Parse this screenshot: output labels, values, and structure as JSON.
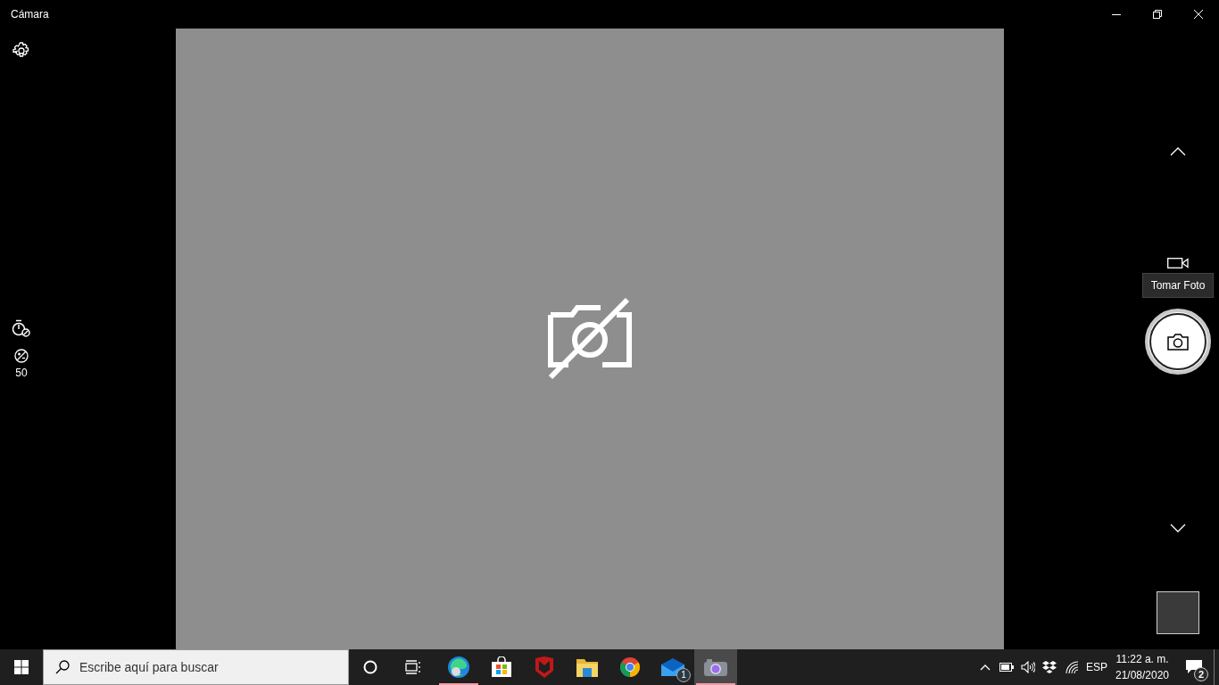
{
  "window": {
    "title": "Cámara"
  },
  "left_controls": [
    {
      "kind": "timer",
      "off": true
    },
    {
      "kind": "exposure",
      "reading": "50"
    }
  ],
  "preview": {
    "camera_available": false
  },
  "capture": {
    "tooltip": "Tomar Foto"
  },
  "taskbar": {
    "search": {
      "placeholder": "Escribe aquí para buscar"
    },
    "apps": [
      {
        "kind": "edge",
        "running": true,
        "active": false
      },
      {
        "kind": "store",
        "running": false,
        "active": false
      },
      {
        "kind": "mcafee",
        "running": false,
        "active": false
      },
      {
        "kind": "explorer",
        "running": false,
        "active": false
      },
      {
        "kind": "chrome",
        "running": false,
        "active": false
      },
      {
        "kind": "mail",
        "running": false,
        "active": false,
        "badge": "1"
      },
      {
        "kind": "camera",
        "running": true,
        "active": true
      }
    ],
    "tray": {
      "language": "ESP",
      "time": "11:22 a. m.",
      "date": "21/08/2020",
      "notifications": "2"
    }
  }
}
